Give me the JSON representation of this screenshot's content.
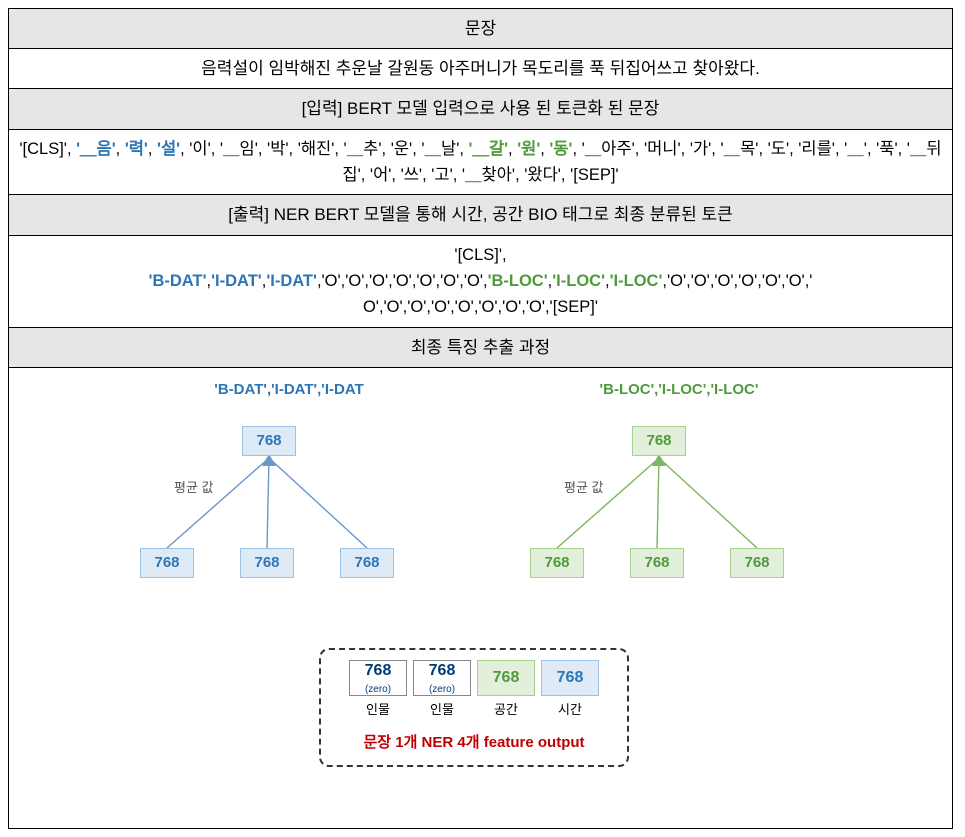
{
  "headers": {
    "h1": "문장",
    "h2": "[입력] BERT 모델 입력으로 사용 된 토큰화 된 문장",
    "h3": "[출력] NER BERT 모델을 통해 시간, 공간 BIO 태그로 최종 분류된 토큰",
    "h4": "최종 특징 추출 과정"
  },
  "sentence": "음력설이 임박해진 추운날 갈원동 아주머니가 목도리를 푹 뒤집어쓰고 찾아왔다.",
  "tokens": [
    {
      "t": "'[CLS]'",
      "c": "black"
    },
    {
      "t": ", ",
      "c": "black"
    },
    {
      "t": "'＿음'",
      "c": "blue"
    },
    {
      "t": ", ",
      "c": "black"
    },
    {
      "t": "'력'",
      "c": "blue"
    },
    {
      "t": ", ",
      "c": "black"
    },
    {
      "t": "'설'",
      "c": "blue"
    },
    {
      "t": ", ",
      "c": "black"
    },
    {
      "t": "'이'",
      "c": "black"
    },
    {
      "t": ", ",
      "c": "black"
    },
    {
      "t": "'＿임'",
      "c": "black"
    },
    {
      "t": ", ",
      "c": "black"
    },
    {
      "t": "'박'",
      "c": "black"
    },
    {
      "t": ", ",
      "c": "black"
    },
    {
      "t": "'해진'",
      "c": "black"
    },
    {
      "t": ", ",
      "c": "black"
    },
    {
      "t": "'＿추'",
      "c": "black"
    },
    {
      "t": ", ",
      "c": "black"
    },
    {
      "t": "'운'",
      "c": "black"
    },
    {
      "t": ", ",
      "c": "black"
    },
    {
      "t": "'＿날'",
      "c": "black"
    },
    {
      "t": ", ",
      "c": "black"
    },
    {
      "t": "'＿갈'",
      "c": "green"
    },
    {
      "t": ", ",
      "c": "black"
    },
    {
      "t": "'원'",
      "c": "green"
    },
    {
      "t": ", ",
      "c": "black"
    },
    {
      "t": "'동'",
      "c": "green"
    },
    {
      "t": ", ",
      "c": "black"
    },
    {
      "t": "'＿아주'",
      "c": "black"
    },
    {
      "t": ", ",
      "c": "black"
    },
    {
      "t": "'머니'",
      "c": "black"
    },
    {
      "t": ", ",
      "c": "black"
    },
    {
      "t": "'가'",
      "c": "black"
    },
    {
      "t": ", ",
      "c": "black"
    },
    {
      "t": "'＿목'",
      "c": "black"
    },
    {
      "t": ", ",
      "c": "black"
    },
    {
      "t": "'도'",
      "c": "black"
    },
    {
      "t": ", ",
      "c": "black"
    },
    {
      "t": "'리를'",
      "c": "black"
    },
    {
      "t": ", ",
      "c": "black"
    },
    {
      "t": "'＿'",
      "c": "black"
    },
    {
      "t": ", ",
      "c": "black"
    },
    {
      "t": "'푹'",
      "c": "black"
    },
    {
      "t": ", ",
      "c": "black"
    },
    {
      "t": "'＿뒤집'",
      "c": "black"
    },
    {
      "t": ", ",
      "c": "black"
    },
    {
      "t": "'어'",
      "c": "black"
    },
    {
      "t": ", ",
      "c": "black"
    },
    {
      "t": "'쓰'",
      "c": "black"
    },
    {
      "t": ", ",
      "c": "black"
    },
    {
      "t": "'고'",
      "c": "black"
    },
    {
      "t": ", ",
      "c": "black"
    },
    {
      "t": "'＿찾아'",
      "c": "black"
    },
    {
      "t": ", ",
      "c": "black"
    },
    {
      "t": "'왔다'",
      "c": "black"
    },
    {
      "t": ", ",
      "c": "black"
    },
    {
      "t": "'[SEP]'",
      "c": "black"
    }
  ],
  "tags_cls": "'[CLS]',",
  "tags": [
    {
      "t": "'B-DAT'",
      "c": "blue"
    },
    {
      "t": ",",
      "c": "black"
    },
    {
      "t": "'I-DAT'",
      "c": "blue"
    },
    {
      "t": ",",
      "c": "black"
    },
    {
      "t": "'I-DAT'",
      "c": "blue"
    },
    {
      "t": ",",
      "c": "black"
    },
    {
      "t": "'O','O','O','O','O','O','O',",
      "c": "black"
    },
    {
      "t": "'B-LOC'",
      "c": "green"
    },
    {
      "t": ",",
      "c": "black"
    },
    {
      "t": "'I-LOC'",
      "c": "green"
    },
    {
      "t": ",",
      "c": "black"
    },
    {
      "t": "'I-LOC'",
      "c": "green"
    },
    {
      "t": ",",
      "c": "black"
    },
    {
      "t": "'O','O','O','O','O','O','",
      "c": "black"
    }
  ],
  "tags_line3": "O','O','O','O','O','O','O','O','[SEP]'",
  "diagram": {
    "left_cap": "'B-DAT','I-DAT','I-DAT",
    "right_cap": "'B-LOC','I-LOC','I-LOC'",
    "dim": "768",
    "avg_label": "평균 값",
    "feature_slots": [
      {
        "val": "768",
        "sub": "(zero)",
        "cap": "인물",
        "style": "white"
      },
      {
        "val": "768",
        "sub": "(zero)",
        "cap": "인물",
        "style": "white"
      },
      {
        "val": "768",
        "sub": "",
        "cap": "공간",
        "style": "g"
      },
      {
        "val": "768",
        "sub": "",
        "cap": "시간",
        "style": "b"
      }
    ],
    "feature_caption": "문장 1개 NER 4개 feature output"
  },
  "chart_data": {
    "type": "diagram",
    "description": "BERT NER token-level feature averaging per entity span",
    "embedding_dim": 768,
    "spans": [
      {
        "label": "DAT",
        "tokens": [
          "＿음",
          "력",
          "설"
        ],
        "agg": "mean"
      },
      {
        "label": "LOC",
        "tokens": [
          "＿갈",
          "원",
          "동"
        ],
        "agg": "mean"
      }
    ],
    "output_features": [
      {
        "name": "인물",
        "dim": 768,
        "value": "zero"
      },
      {
        "name": "인물",
        "dim": 768,
        "value": "zero"
      },
      {
        "name": "공간",
        "dim": 768,
        "source": "LOC"
      },
      {
        "name": "시간",
        "dim": 768,
        "source": "DAT"
      }
    ]
  }
}
